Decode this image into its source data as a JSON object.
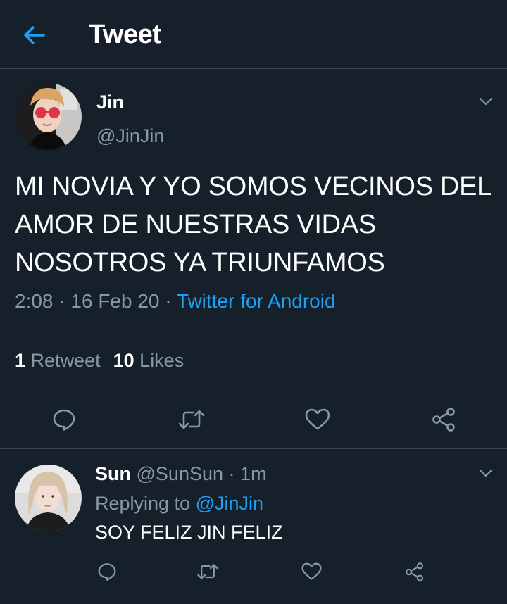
{
  "header": {
    "title": "Tweet",
    "back_icon": "arrow-left-icon",
    "accent": "#1da1f2",
    "background": "#15202b"
  },
  "tweet": {
    "author_name": "Jin",
    "author_handle": "@JinJin",
    "text": "MI NOVIA Y YO SOMOS VECINOS DEL AMOR DE NUESTRAS VIDAS NOSOTROS YA TRIUNFAMOS",
    "time": "2:08",
    "date": "16 Feb 20",
    "separator": "·",
    "source": "Twitter for Android",
    "retweet_count": "1",
    "retweet_label": "Retweet",
    "like_count": "10",
    "like_label": "Likes",
    "actions": [
      "reply-icon",
      "retweet-icon",
      "like-icon",
      "share-icon"
    ]
  },
  "reply": {
    "author_name": "Sun",
    "author_handle": "@SunSun",
    "separator": "·",
    "time": "1m",
    "replying_to_label": "Replying to",
    "replying_to_handle": "@JinJin",
    "text": "SOY FELIZ JIN FELIZ",
    "actions": [
      "reply-icon",
      "retweet-icon",
      "like-icon",
      "share-icon"
    ]
  },
  "colors": {
    "text_primary": "#ffffff",
    "text_secondary": "#8899a6",
    "divider": "#38444d"
  }
}
